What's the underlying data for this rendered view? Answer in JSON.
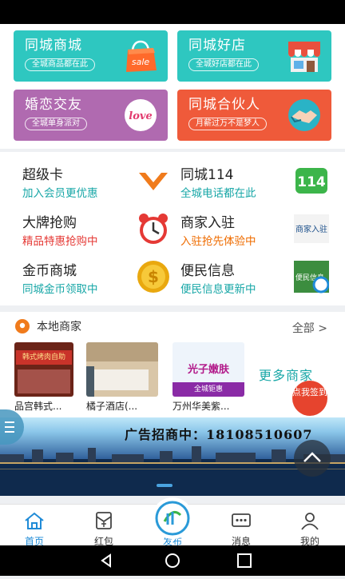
{
  "banners": [
    {
      "title": "同城商城",
      "sub": "全城商品都在此",
      "icon": "shopping-bag-sale-icon"
    },
    {
      "title": "同城好店",
      "sub": "全城好店都在此",
      "icon": "storefront-icon"
    },
    {
      "title": "婚恋交友",
      "sub": "全城单身派对",
      "icon": "love-heart-icon"
    },
    {
      "title": "同城合伙人",
      "sub": "月薪过万不是梦人",
      "icon": "handshake-icon"
    }
  ],
  "services": [
    {
      "name": "超级卡",
      "desc": "加入会员更优惠",
      "icon": "chevron-v-icon"
    },
    {
      "name": "同城114",
      "desc": "全城电话都在此",
      "icon_text": "114"
    },
    {
      "name": "大牌抢购",
      "desc": "精品特惠抢购中",
      "icon": "alarm-clock-icon"
    },
    {
      "name": "商家入驻",
      "desc": "入驻抢先体验中",
      "icon_text": "商家入驻"
    },
    {
      "name": "金币商城",
      "desc": "同城金币领取中",
      "icon": "gold-coin-icon"
    },
    {
      "name": "便民信息",
      "desc": "便民信息更新中",
      "icon_text": "便民信息"
    }
  ],
  "merchants": {
    "title": "本地商家",
    "all": "全部 >",
    "items": [
      {
        "caption": "品宫韩式...",
        "sign": "韩式烤肉自助"
      },
      {
        "caption": "橘子酒店(..."
      },
      {
        "caption": "万州华美紫...",
        "sign": "光子嫩肤",
        "sign_sub": "全城钜惠"
      }
    ],
    "more": "更多商家",
    "signin": "点我签到"
  },
  "ad": {
    "text": "广告招商中：18108510607"
  },
  "tabs": [
    {
      "label": "首页",
      "icon": "home-icon"
    },
    {
      "label": "红包",
      "icon": "red-envelope-icon"
    },
    {
      "label": "发布",
      "icon": "publish-icon"
    },
    {
      "label": "消息",
      "icon": "message-icon"
    },
    {
      "label": "我的",
      "icon": "user-icon"
    }
  ],
  "colors": {
    "teal": "#2ec7c0",
    "purple": "#b06ab0",
    "orange_red": "#ef5a3a",
    "active_tab": "#1f8bd7"
  }
}
